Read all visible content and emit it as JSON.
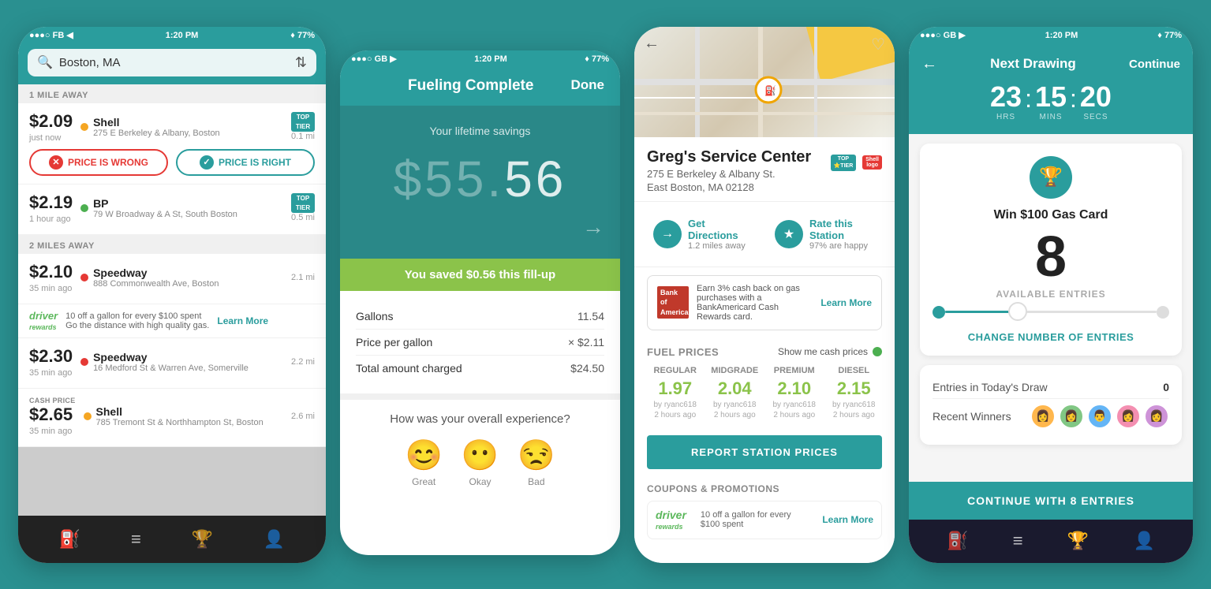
{
  "phone1": {
    "status": {
      "left": "●●●○ FB  ◀",
      "time": "1:20 PM",
      "right": "♦ 77%"
    },
    "search_placeholder": "Boston, MA",
    "section1": "1 MILE AWAY",
    "section2": "2 MILES AWAY",
    "stations": [
      {
        "price": "$2.09",
        "time_ago": "just now",
        "brand": "Shell",
        "address": "275 E Berkeley & Albany, Boston",
        "distance": "0.1 mi",
        "dot_color": "orange",
        "top_tier": true,
        "show_buttons": true
      },
      {
        "price": "$2.19",
        "time_ago": "1 hour ago",
        "brand": "BP",
        "address": "79 W Broadway & A St, South Boston",
        "distance": "0.5 mi",
        "dot_color": "green",
        "top_tier": true,
        "show_buttons": false
      },
      {
        "price": "$2.10",
        "time_ago": "35 min ago",
        "brand": "Speedway",
        "address": "888 Commonwealth Ave, Boston",
        "distance": "2.1 mi",
        "dot_color": "red",
        "top_tier": false,
        "show_driver_rewards": true
      },
      {
        "price": "$2.30",
        "time_ago": "35 min ago",
        "brand": "Speedway",
        "address": "16 Medford St & Warren Ave, Somerville",
        "distance": "2.2 mi",
        "dot_color": "red",
        "top_tier": false
      },
      {
        "price": "$2.65",
        "time_ago": "35 min ago",
        "brand": "Shell",
        "address": "785 Tremont St & Northhampton St, Boston",
        "distance": "2.6 mi",
        "dot_color": "orange",
        "cash_price": true
      }
    ],
    "btn_wrong": "PRICE IS WRONG",
    "btn_right": "PRICE IS RIGHT",
    "driver_rewards_text": "10 off a gallon for every $100 spent",
    "driver_rewards_sub": "Go the distance with high quality gas.",
    "dr_learn": "Learn More",
    "cash_price_label": "CASH PRICE"
  },
  "phone2": {
    "status": {
      "left": "●●●○ GB  ▶",
      "time": "1:20 PM",
      "right": "♦ 77%"
    },
    "title": "Fueling Complete",
    "done_label": "Done",
    "lifetime_label": "Your lifetime savings",
    "amount_digits": [
      "$",
      "5",
      "5",
      ".",
      "5",
      "6"
    ],
    "saved_banner": "You saved $0.56 this fill-up",
    "details": [
      {
        "label": "Gallons",
        "value": "11.54"
      },
      {
        "label": "Price per gallon",
        "value": "× $2.11"
      },
      {
        "label": "Total amount charged",
        "value": "$24.50"
      }
    ],
    "exp_label": "How was your overall experience?",
    "emojis": [
      {
        "face": "😊",
        "label": "Great"
      },
      {
        "face": "😐",
        "label": "Okay"
      },
      {
        "face": "😒",
        "label": "Bad"
      }
    ]
  },
  "phone3": {
    "station_name": "Greg's Service Center",
    "station_addr1": "275 E Berkeley & Albany St.",
    "station_addr2": "East Boston, MA 02128",
    "directions_label": "Get Directions",
    "directions_sub": "1.2 miles away",
    "rate_label": "Rate this Station",
    "rate_sub": "97% are happy",
    "bofa_text": "Earn 3% cash back on gas purchases with a BankAmericard Cash Rewards card.",
    "bofa_learn": "Learn More",
    "fuel_title": "FUEL PRICES",
    "cash_toggle": "Show me cash prices",
    "fuel_types": [
      "REGULAR",
      "MIDGRADE",
      "PREMIUM",
      "DIESEL"
    ],
    "fuel_prices": [
      "1.97",
      "2.04",
      "2.10",
      "2.15"
    ],
    "fuel_reporter": "by ryanc618",
    "fuel_time": "2 hours ago",
    "report_btn": "REPORT STATION PRICES",
    "coupons_title": "COUPONS & PROMOTIONS",
    "dr_promo": "10 off a gallon for every $100 spent",
    "dr_learn": "Learn More"
  },
  "phone4": {
    "status": {
      "left": "●●●○ GB  ▶",
      "time": "1:20 PM",
      "right": "♦ 77%"
    },
    "back_label": "←",
    "title": "Next Drawing",
    "continue_label": "Continue",
    "timer": {
      "hrs": "23",
      "mins": "15",
      "secs": "20"
    },
    "timer_labels": [
      "HRS",
      "MINS",
      "SECS"
    ],
    "prize_title": "Win $100 Gas Card",
    "entries_count": "8",
    "available_entries_label": "AVAILABLE ENTRIES",
    "change_entries_label": "CHANGE NUMBER OF ENTRIES",
    "entries_today_label": "Entries in Today's Draw",
    "entries_today_val": "0",
    "recent_winners_label": "Recent Winners",
    "cta_label": "CONTINUE WITH 8 ENTRIES",
    "nav_icons": [
      "⛽",
      "≡",
      "🏆",
      "👤"
    ]
  }
}
